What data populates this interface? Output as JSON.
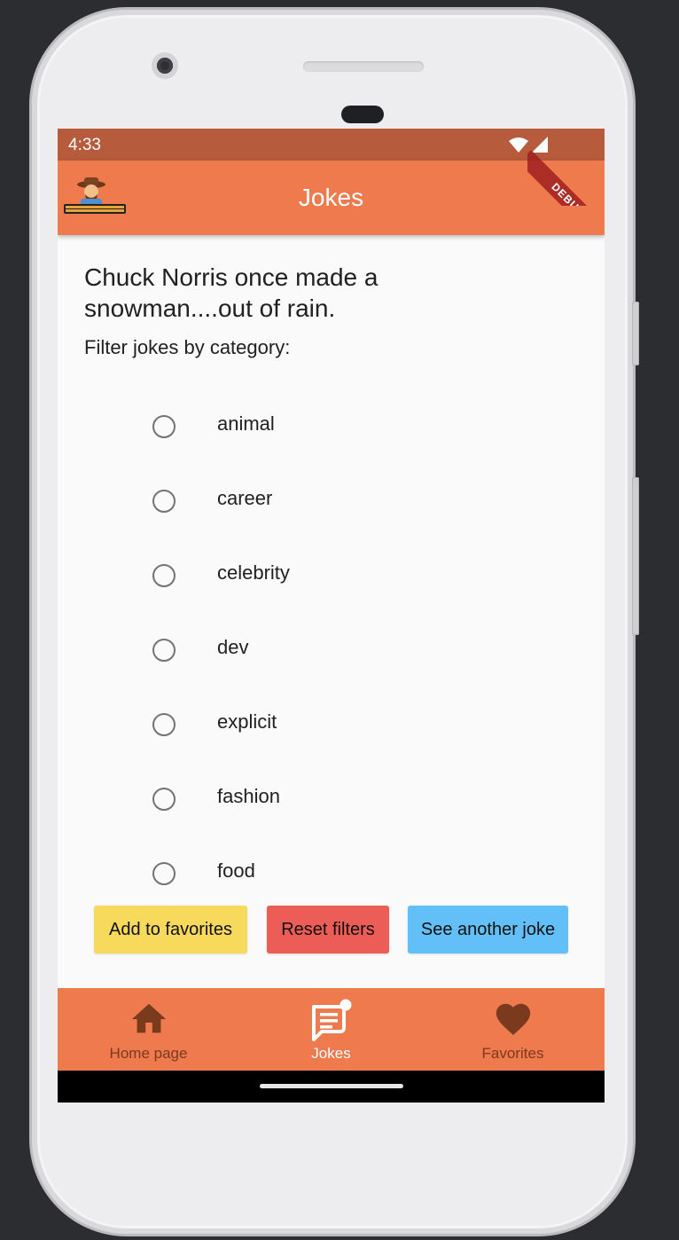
{
  "status_bar": {
    "time": "4:33"
  },
  "debug_banner": {
    "label": "DEBUG"
  },
  "app_bar": {
    "title": "Jokes"
  },
  "joke": {
    "text": "Chuck Norris once made a snowman....out of rain."
  },
  "filter": {
    "label": "Filter jokes by category:",
    "categories": [
      "animal",
      "career",
      "celebrity",
      "dev",
      "explicit",
      "fashion",
      "food"
    ]
  },
  "actions": {
    "add_favorites": "Add to favorites",
    "reset_filters": "Reset filters",
    "see_another": "See another joke"
  },
  "bottom_nav": {
    "home": "Home page",
    "jokes": "Jokes",
    "favorites": "Favorites",
    "active": "jokes"
  },
  "colors": {
    "app_bar": "#ee7a4e",
    "status_bar": "#b65c3c",
    "add_button": "#f7d95c",
    "reset_button": "#ec5d57",
    "another_button": "#62bff7"
  }
}
